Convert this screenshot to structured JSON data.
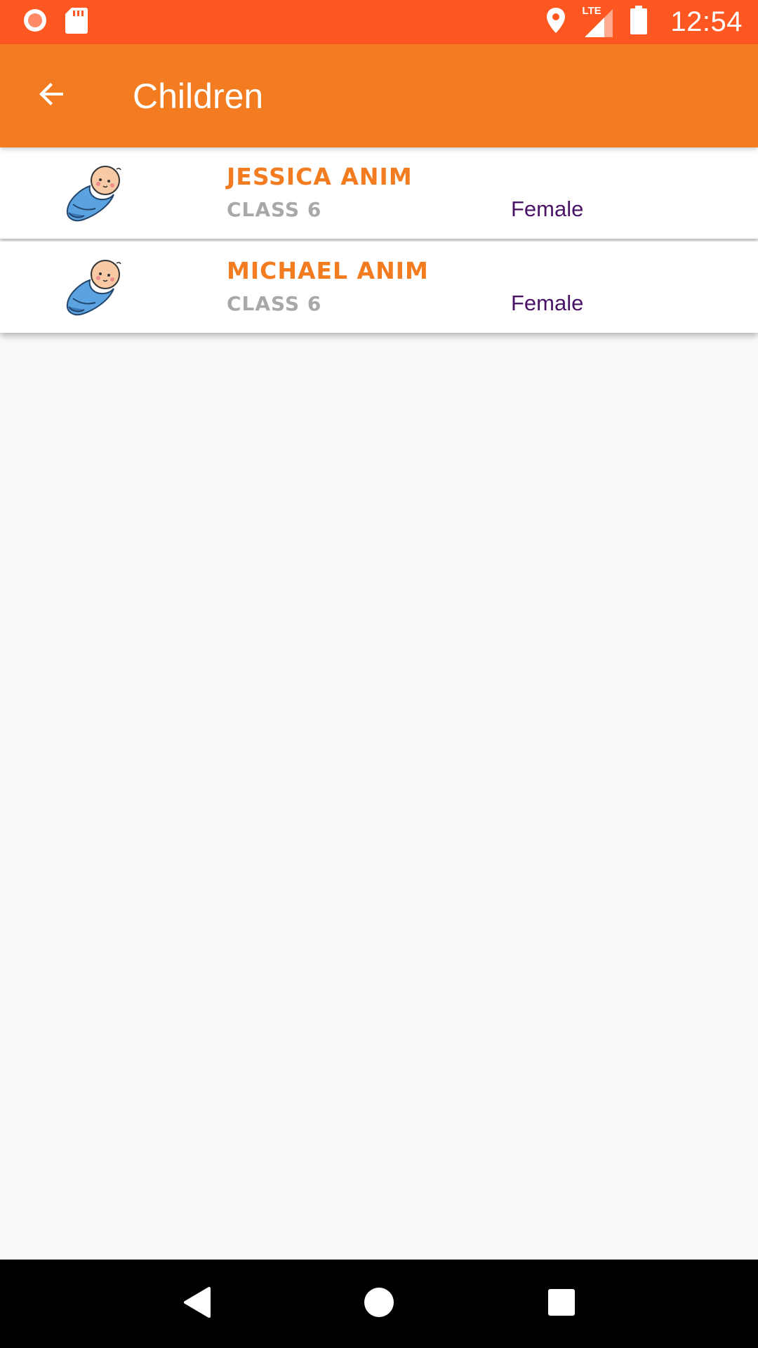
{
  "status_bar": {
    "time": "12:54",
    "icons": [
      "record-icon",
      "sd-card-icon",
      "location-icon",
      "lte-signal-icon",
      "battery-icon"
    ],
    "network_label": "LTE",
    "background": "#ff5722"
  },
  "app_bar": {
    "title": "Children",
    "back_icon": "arrow-back-icon",
    "background": "#f47c20"
  },
  "children": [
    {
      "name": "Jessica Anim",
      "class": "Class 6",
      "gender": "Female",
      "avatar_icon": "baby-avatar-icon"
    },
    {
      "name": "Michael Anim",
      "class": "Class 6",
      "gender": "Female",
      "avatar_icon": "baby-avatar-icon"
    }
  ],
  "nav_bar": {
    "buttons": [
      "back-triangle-icon",
      "home-circle-icon",
      "recents-square-icon"
    ]
  },
  "colors": {
    "accent": "#f47c20",
    "class_text": "#a8a8a8",
    "gender_text": "#4a1466"
  }
}
